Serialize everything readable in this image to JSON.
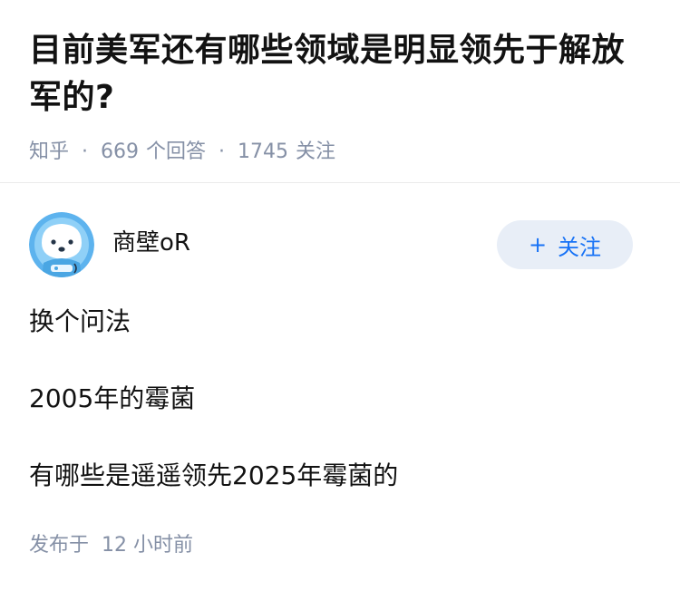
{
  "question": {
    "title": "目前美军还有哪些领域是明显领先于解放军的?",
    "site": "知乎",
    "answer_count": "669",
    "answer_label": "个回答",
    "follower_count": "1745",
    "follower_label": "关注"
  },
  "answer": {
    "author_name": "商壁oR",
    "follow_label": "关注",
    "follow_icon": "plus-icon",
    "paragraphs": [
      "换个问法",
      "2005年的霉菌",
      "有哪些是遥遥领先2025年霉菌的"
    ],
    "published_prefix": "发布于",
    "published_time": "12 小时前"
  },
  "colors": {
    "accent": "#1772f6",
    "follow_bg": "#e8eef7",
    "meta": "#8590a6",
    "text": "#121212"
  }
}
